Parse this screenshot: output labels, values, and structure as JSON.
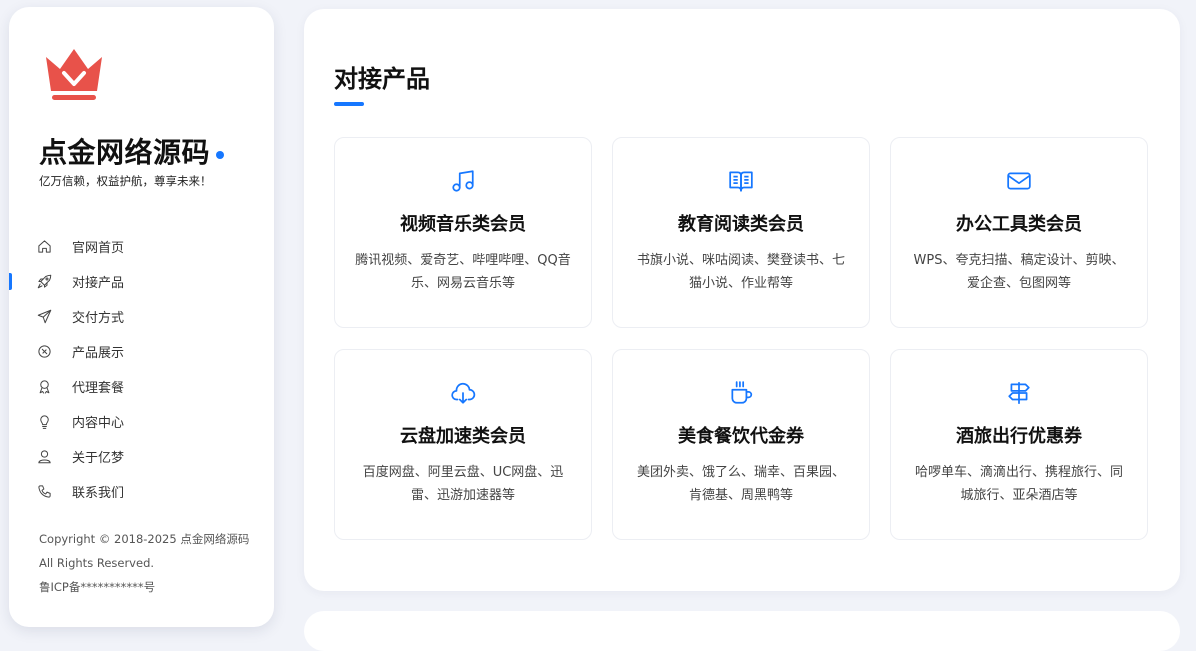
{
  "brand": {
    "name": "点金网络源码",
    "slogan": "亿万信赖，权益护航，尊享未来！",
    "colors": {
      "accent": "#1677ff",
      "logo": "#e8524a"
    }
  },
  "nav": [
    {
      "label": "官网首页",
      "icon": "home-icon",
      "active": false
    },
    {
      "label": "对接产品",
      "icon": "rocket-icon",
      "active": true
    },
    {
      "label": "交付方式",
      "icon": "send-icon",
      "active": false
    },
    {
      "label": "产品展示",
      "icon": "compass-icon",
      "active": false
    },
    {
      "label": "代理套餐",
      "icon": "award-icon",
      "active": false
    },
    {
      "label": "内容中心",
      "icon": "bulb-icon",
      "active": false
    },
    {
      "label": "关于亿梦",
      "icon": "user-icon",
      "active": false
    },
    {
      "label": "联系我们",
      "icon": "phone-icon",
      "active": false
    }
  ],
  "footer": {
    "copyright": "Copyright © 2018-2025 点金网络源码",
    "rights": "All Rights Reserved.",
    "icp": "鲁ICP备***********号"
  },
  "section": {
    "title": "对接产品",
    "cards": [
      {
        "icon": "music-icon",
        "title": "视频音乐类会员",
        "desc": "腾讯视频、爱奇艺、哔哩哔哩、QQ音乐、网易云音乐等"
      },
      {
        "icon": "book-icon",
        "title": "教育阅读类会员",
        "desc": "书旗小说、咪咕阅读、樊登读书、七猫小说、作业帮等"
      },
      {
        "icon": "mail-icon",
        "title": "办公工具类会员",
        "desc": "WPS、夸克扫描、稿定设计、剪映、爱企查、包图网等"
      },
      {
        "icon": "cloud-download-icon",
        "title": "云盘加速类会员",
        "desc": "百度网盘、阿里云盘、UC网盘、迅雷、迅游加速器等"
      },
      {
        "icon": "coffee-icon",
        "title": "美食餐饮代金券",
        "desc": "美团外卖、饿了么、瑞幸、百果园、肯德基、周黑鸭等"
      },
      {
        "icon": "signpost-icon",
        "title": "酒旅出行优惠券",
        "desc": "哈啰单车、滴滴出行、携程旅行、同城旅行、亚朵酒店等"
      }
    ]
  }
}
